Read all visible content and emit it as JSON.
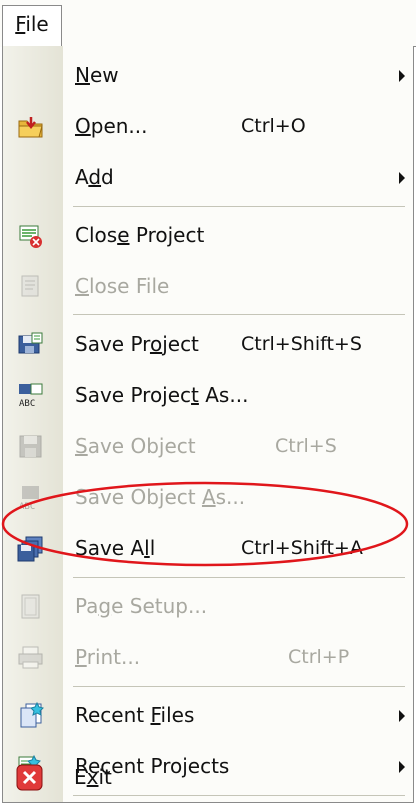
{
  "menubar": {
    "file_label": "File"
  },
  "menu": {
    "items": [
      {
        "label": "New",
        "shortcut": "",
        "submenu": true,
        "enabled": true,
        "icon": "none"
      },
      {
        "label": "Open...",
        "shortcut": "Ctrl+O",
        "submenu": false,
        "enabled": true,
        "icon": "open-folder-icon"
      },
      {
        "label": "Add",
        "shortcut": "",
        "submenu": true,
        "enabled": true,
        "icon": "none"
      },
      {
        "label": "Close Project",
        "shortcut": "",
        "submenu": false,
        "enabled": true,
        "icon": "close-project-icon"
      },
      {
        "label": "Close File",
        "shortcut": "",
        "submenu": false,
        "enabled": false,
        "icon": "close-file-icon"
      },
      {
        "label": "Save Project",
        "shortcut": "Ctrl+Shift+S",
        "submenu": false,
        "enabled": true,
        "icon": "save-project-icon"
      },
      {
        "label": "Save Project As...",
        "shortcut": "",
        "submenu": false,
        "enabled": true,
        "icon": "save-project-as-icon"
      },
      {
        "label": "Save Object",
        "shortcut": "Ctrl+S",
        "submenu": false,
        "enabled": false,
        "icon": "save-object-icon"
      },
      {
        "label": "Save Object As...",
        "shortcut": "",
        "submenu": false,
        "enabled": false,
        "icon": "save-object-as-icon"
      },
      {
        "label": "Save All",
        "shortcut": "Ctrl+Shift+A",
        "submenu": false,
        "enabled": true,
        "icon": "save-all-icon"
      },
      {
        "label": "Page Setup...",
        "shortcut": "",
        "submenu": false,
        "enabled": false,
        "icon": "page-setup-icon"
      },
      {
        "label": "Print...",
        "shortcut": "Ctrl+P",
        "submenu": false,
        "enabled": false,
        "icon": "print-icon"
      },
      {
        "label": "Recent Files",
        "shortcut": "",
        "submenu": true,
        "enabled": true,
        "icon": "recent-files-icon"
      },
      {
        "label": "Recent Projects",
        "shortcut": "",
        "submenu": true,
        "enabled": true,
        "icon": "recent-projects-icon"
      },
      {
        "label": "Exit",
        "shortcut": "",
        "submenu": false,
        "enabled": true,
        "icon": "exit-icon"
      }
    ]
  },
  "annotation": {
    "highlighted_item": "Save All",
    "color": "#e0161b"
  },
  "colors": {
    "disabled_text": "#a8a8a0",
    "menu_bg": "#fcfcf9",
    "icon_strip": "#e4e3d6"
  }
}
